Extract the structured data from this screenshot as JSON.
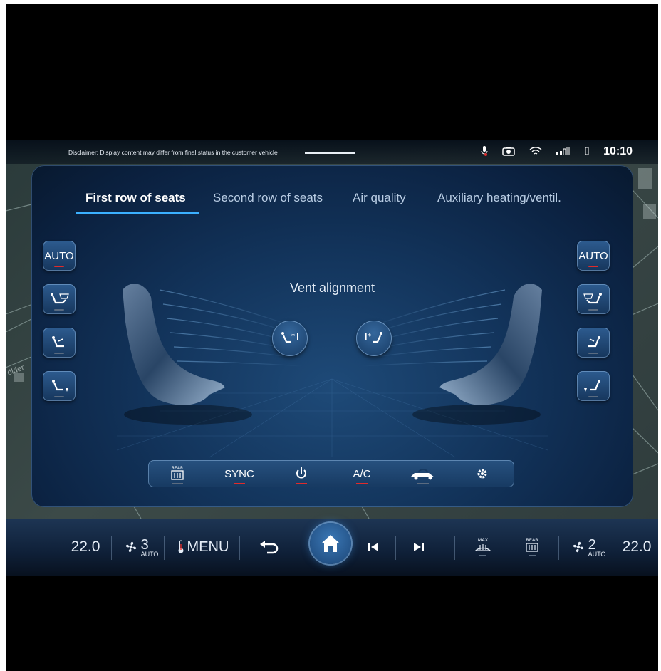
{
  "status_bar": {
    "disclaimer": "Disclaimer: Display content may differ from final status in the customer vehicle",
    "time": "10:10",
    "icons": [
      "mic-icon",
      "camera-icon",
      "wifi-icon",
      "signal-icon",
      "battery-icon"
    ]
  },
  "map": {
    "street_label": "ölder"
  },
  "tabs": [
    {
      "label": "First row of seats",
      "active": true
    },
    {
      "label": "Second row of seats",
      "active": false
    },
    {
      "label": "Air quality",
      "active": false
    },
    {
      "label": "Auxiliary heating/ventil.",
      "active": false
    }
  ],
  "left_controls": {
    "auto_label": "AUTO",
    "buttons": [
      "airflow-windshield-icon",
      "airflow-upper-icon",
      "airflow-lower-icon"
    ]
  },
  "right_controls": {
    "auto_label": "AUTO",
    "buttons": [
      "airflow-windshield-icon",
      "airflow-upper-icon",
      "airflow-lower-icon"
    ]
  },
  "vent": {
    "title": "Vent alignment",
    "buttons": [
      "vent-driver-icon",
      "vent-passenger-icon"
    ]
  },
  "climate_bar": {
    "rear_defrost_label": "REAR",
    "sync_label": "SYNC",
    "ac_label": "A/C",
    "items": [
      "rear-defrost-icon",
      "sync",
      "climate-power-icon",
      "ac",
      "recirculation-icon",
      "settings-icon"
    ]
  },
  "dock": {
    "temp_left": "22.0",
    "fan_left": "3",
    "fan_left_mode": "AUTO",
    "menu_label": "MENU",
    "max_label": "MAX",
    "rear_label": "REAR",
    "fan_right": "2",
    "fan_right_mode": "AUTO",
    "temp_right": "22.0"
  },
  "colors": {
    "accent": "#3bb0ff",
    "active_indicator": "#e02b2b",
    "panel": "#12335a"
  }
}
